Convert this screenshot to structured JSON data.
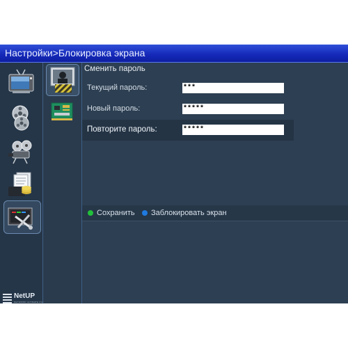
{
  "titlebar": {
    "breadcrumb": "Настройки>Блокировка экрана"
  },
  "sidebar": {
    "items": [
      {
        "icon": "tv-icon"
      },
      {
        "icon": "film-reels-icon"
      },
      {
        "icon": "projector-icon"
      },
      {
        "icon": "documents-coins-icon"
      },
      {
        "icon": "settings-tools-icon",
        "selected": true
      }
    ],
    "logo": {
      "text": "NetUP",
      "tagline": "NETWORK ULTIMATE PLATFORM"
    }
  },
  "subnav": {
    "items": [
      {
        "icon": "lock-screen-icon",
        "selected": true
      },
      {
        "icon": "circuit-board-icon"
      }
    ]
  },
  "main": {
    "section_title": "Сменить пароль",
    "fields": {
      "current": {
        "label": "Текущий пароль:",
        "value": "***"
      },
      "new": {
        "label": "Новый пароль:",
        "value": "*****"
      },
      "repeat": {
        "label": "Повторите пароль:",
        "value": "*****"
      }
    },
    "actions": {
      "save": {
        "label": "Сохранить",
        "color": "#22c03a"
      },
      "lock": {
        "label": "Заблокировать экран",
        "color": "#1f7ae0"
      }
    }
  },
  "colors": {
    "titlebar": "#1a30c8",
    "background": "#2d3f52",
    "sidebar": "#253648",
    "highlight_row": "#243445"
  }
}
